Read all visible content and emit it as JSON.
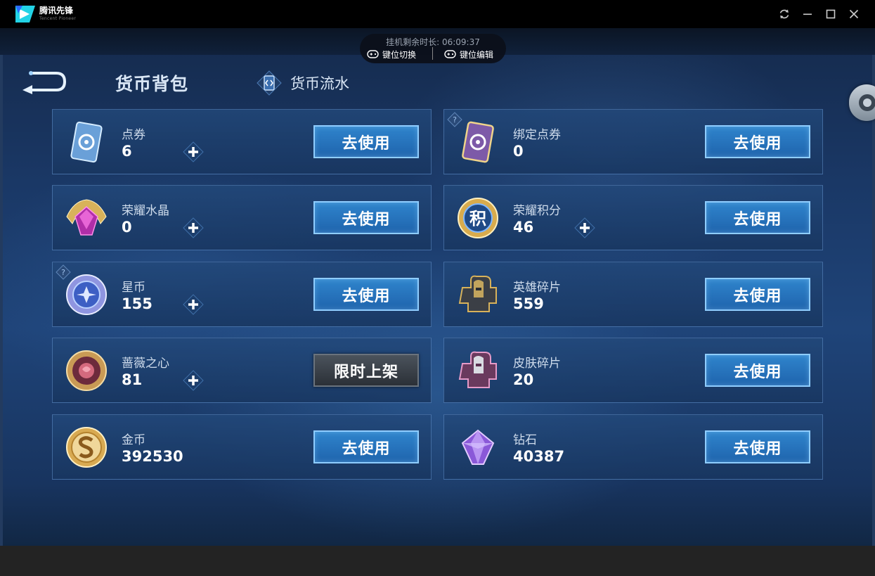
{
  "window": {
    "app_name": "腾讯先锋",
    "app_subtitle": "Tencent Pioneer",
    "controls": [
      "refresh-icon",
      "minimize-icon",
      "maximize-icon",
      "close-icon"
    ]
  },
  "overlay": {
    "timer_text": "挂机剩余时长: 06:09:37",
    "key_switch": "键位切换",
    "key_edit": "键位编辑"
  },
  "header": {
    "title": "货币背包",
    "flow_tab": "货币流水"
  },
  "currencies": {
    "c1": {
      "name": "点券",
      "amount": "6",
      "button": "去使用"
    },
    "c2": {
      "name": "绑定点券",
      "amount": "0",
      "button": "去使用"
    },
    "c3": {
      "name": "荣耀水晶",
      "amount": "0",
      "button": "去使用"
    },
    "c4": {
      "name": "荣耀积分",
      "amount": "46",
      "button": "去使用"
    },
    "c5": {
      "name": "星币",
      "amount": "155",
      "button": "去使用"
    },
    "c6": {
      "name": "英雄碎片",
      "amount": "559",
      "button": "去使用"
    },
    "c7": {
      "name": "蔷薇之心",
      "amount": "81",
      "button": "限时上架"
    },
    "c8": {
      "name": "皮肤碎片",
      "amount": "20",
      "button": "去使用"
    },
    "c9": {
      "name": "金币",
      "amount": "392530",
      "button": "去使用"
    },
    "c10": {
      "name": "钻石",
      "amount": "40387",
      "button": "去使用"
    },
    "c4_icon_text": "积"
  },
  "colors": {
    "accent_button": "#2f84cc",
    "button_border": "#8fcdff",
    "limited_button": "#4b535c",
    "card_border": "#6ea0dc",
    "background": "#1f4479"
  }
}
